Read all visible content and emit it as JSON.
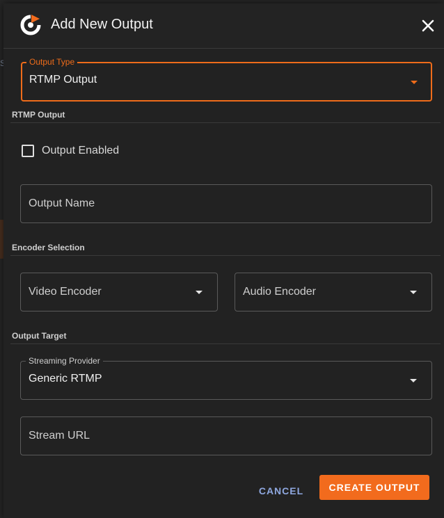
{
  "dialog": {
    "title": "Add New Output",
    "logo_icon": "restream-logo-icon",
    "close_icon": "close-icon"
  },
  "colors": {
    "accent": "#f26b1d",
    "link": "#8fa8e0"
  },
  "output_type": {
    "legend": "Output Type",
    "value": "RTMP Output"
  },
  "sections": {
    "rtmp_output": "RTMP Output",
    "encoder_selection": "Encoder Selection",
    "output_target": "Output Target"
  },
  "output_enabled": {
    "label": "Output Enabled",
    "checked": false
  },
  "output_name": {
    "placeholder": "Output Name"
  },
  "video_encoder": {
    "placeholder": "Video Encoder"
  },
  "audio_encoder": {
    "placeholder": "Audio Encoder"
  },
  "streaming_provider": {
    "legend": "Streaming Provider",
    "value": "Generic RTMP"
  },
  "stream_url": {
    "placeholder": "Stream URL"
  },
  "buttons": {
    "cancel": "CANCEL",
    "create": "CREATE OUTPUT"
  },
  "backdrop": {
    "peek_text": "S|"
  }
}
